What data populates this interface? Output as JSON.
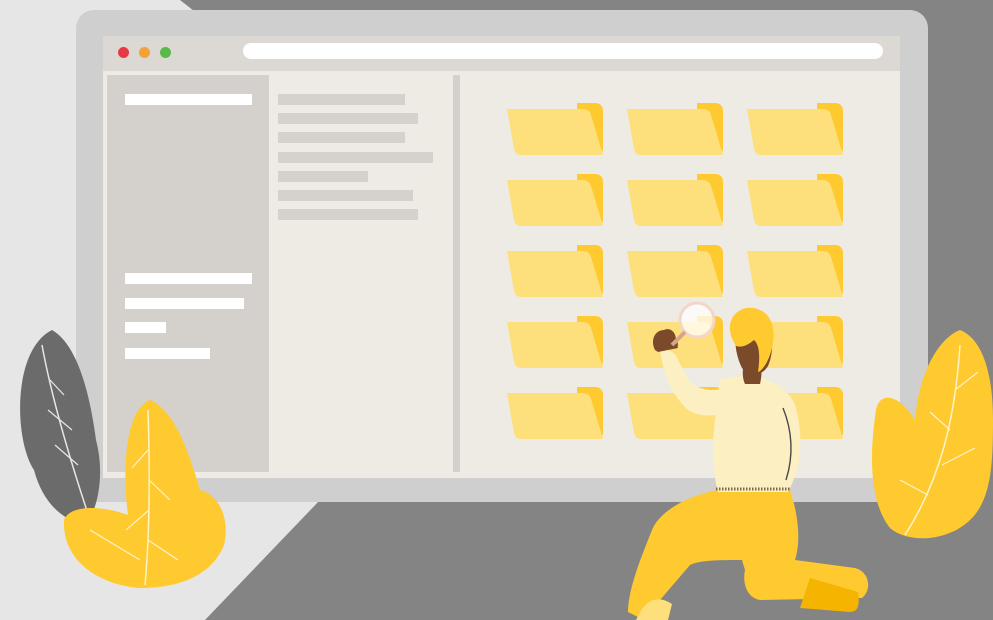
{
  "colors": {
    "background_dark": "#848485",
    "background_light": "#e6e6e6",
    "laptop_frame": "#cfcfcf",
    "screen": "#eeebe5",
    "sidebar": "#d4d1cc",
    "folder_front": "#fde07c",
    "folder_back": "#ffc930",
    "leaf_yellow": "#ffc930",
    "leaf_gray": "#6b6b6b",
    "person_shirt": "#fcefc2",
    "person_pants": "#ffc930",
    "person_skin": "#7b4a2a",
    "traffic_red": "#e63946",
    "traffic_yellow": "#f4a236",
    "traffic_green": "#59b94a"
  },
  "window": {
    "controls": [
      "close",
      "minimize",
      "maximize"
    ]
  },
  "sidebar": {
    "items": [
      "placeholder",
      "placeholder",
      "placeholder",
      "placeholder",
      "placeholder"
    ]
  },
  "file_list": {
    "rows": [
      "placeholder",
      "placeholder",
      "placeholder",
      "placeholder",
      "placeholder",
      "placeholder",
      "placeholder"
    ]
  },
  "folder_grid": {
    "rows": 5,
    "columns": 3,
    "icon": "folder-icon"
  },
  "illustration": {
    "figure": "person-kneeling-with-magnifier",
    "plants": [
      "leaf-gray-left",
      "leaf-yellow-left",
      "leaf-yellow-right"
    ]
  }
}
